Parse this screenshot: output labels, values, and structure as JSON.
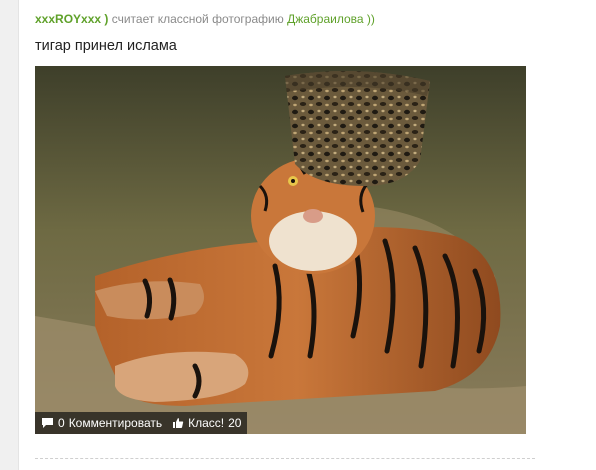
{
  "feed_item": {
    "username": "xxxROYxxx )",
    "action_text": "считает классной фотографию",
    "author": "Джабраилова ))",
    "caption": "тигар принел ислама",
    "stats": {
      "comments_count": "0",
      "comments_label": "Комментировать",
      "likes_label": "Класс!",
      "likes_count": "20"
    }
  },
  "colors": {
    "link_green": "#5fa12a",
    "meta_gray": "#8a8a8a",
    "overlay_bg": "#141414"
  },
  "icons": [
    "comment-bubble-icon",
    "thumbs-up-icon"
  ]
}
